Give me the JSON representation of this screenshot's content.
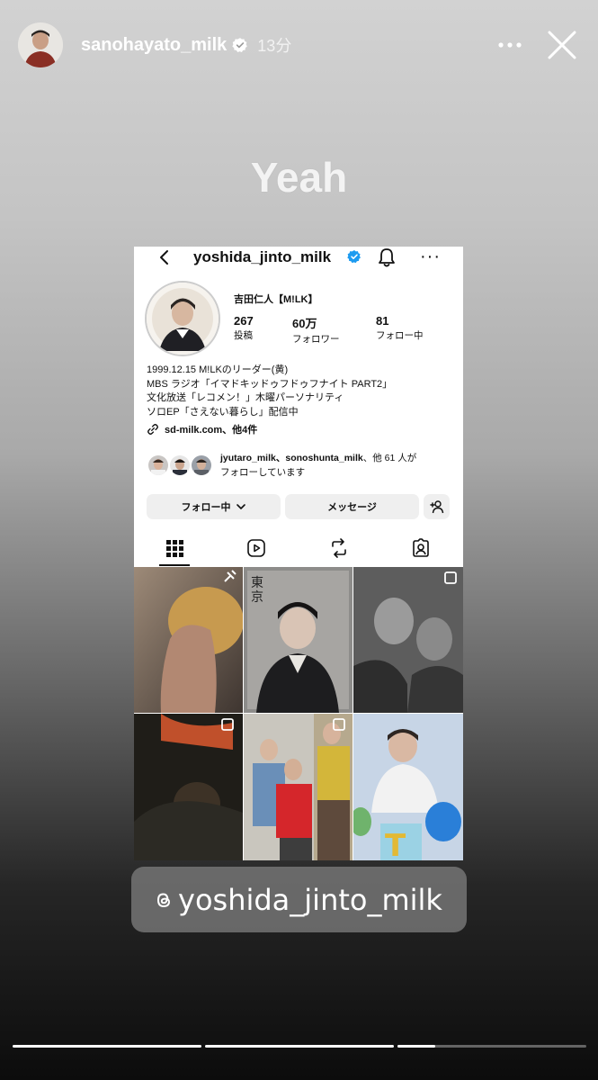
{
  "story": {
    "username": "sanohayato_milk",
    "time": "13分",
    "caption": "Yeah",
    "mention": "yoshida_jinto_milk",
    "progress": [
      1.0,
      1.0,
      0.2
    ]
  },
  "profile": {
    "username": "yoshida_jinto_milk",
    "display_name": "吉田仁人【M!LK】",
    "stats": [
      {
        "num": "267",
        "label": "投稿"
      },
      {
        "num": "60万",
        "label": "フォロワー"
      },
      {
        "num": "81",
        "label": "フォロー中"
      }
    ],
    "bio": [
      "1999.12.15 M!LKのリーダー(黄)",
      "MBS ラジオ「イマドキッドゥフドゥフナイト PART2」",
      "文化放送「レコメン！」木曜パーソナリティ",
      "ソロEP「さえない暮らし」配信中"
    ],
    "link": "sd-milk.com、他4件",
    "followed_by_names": "jyutaro_milk、sonoshunta_milk",
    "followed_by_rest": "、他 61 人が",
    "followed_by_line2": "フォローしています",
    "follow_button": "フォロー中",
    "message_button": "メッセージ"
  },
  "icons": {
    "verified": "verified-badge-icon",
    "more": "more-dots-icon",
    "close": "close-icon",
    "back": "chevron-left-icon",
    "bell": "bell-icon",
    "link": "link-icon",
    "add_person": "add-person-icon",
    "grid": "grid-icon",
    "reels": "reels-icon",
    "reposts": "repost-icon",
    "tagged": "tagged-icon",
    "threads": "threads-icon"
  },
  "colors": {
    "verified_blue": "#1d9bf0",
    "button_gray": "#efefef"
  }
}
